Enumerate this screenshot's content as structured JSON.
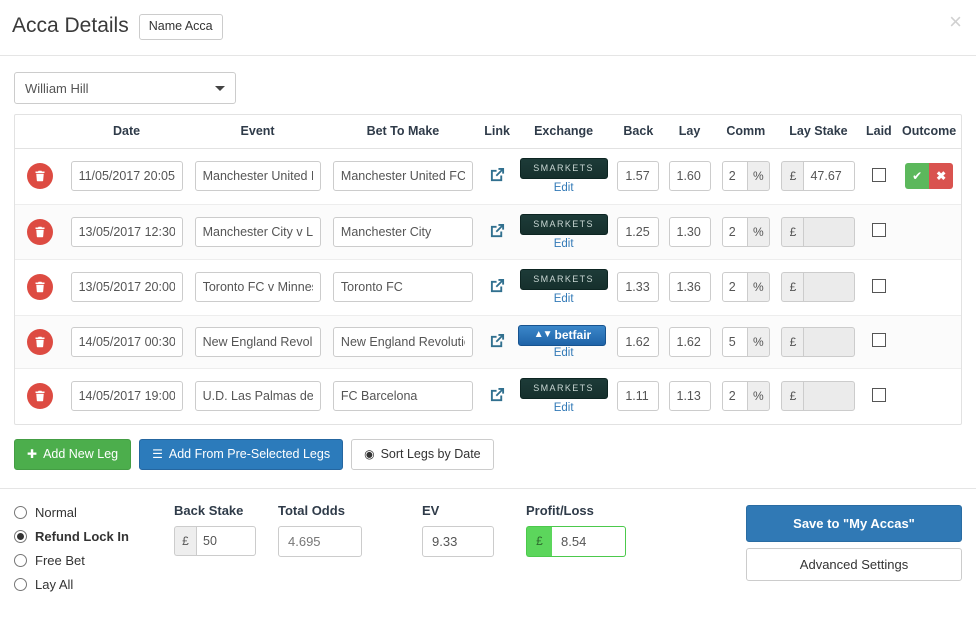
{
  "header": {
    "title": "Acca Details",
    "name_acca_label": "Name Acca",
    "close_icon": "close-icon"
  },
  "bookmaker": {
    "selected": "William Hill",
    "caret_icon": "chevron-down-icon"
  },
  "table": {
    "columns": [
      "",
      "Date",
      "Event",
      "Bet To Make",
      "Link",
      "Exchange",
      "Back",
      "Lay",
      "Comm",
      "Lay Stake",
      "Laid",
      "Outcome"
    ],
    "rows": [
      {
        "date": "11/05/2017 20:05",
        "event": "Manchester United FC ",
        "bet": "Manchester United FC",
        "link_icon": "external-link-icon",
        "exchange": "SMARKETS",
        "exchange_key": "smarkets",
        "edit_label": "Edit",
        "back": "1.57",
        "lay": "1.60",
        "comm": "2",
        "comm_unit": "%",
        "stake_currency": "£",
        "lay_stake": "47.67",
        "stake_disabled": false,
        "laid": false,
        "has_outcome": true,
        "win_icon": "✔",
        "lose_icon": "✖"
      },
      {
        "date": "13/05/2017 12:30",
        "event": "Manchester City v Leice",
        "bet": "Manchester City",
        "link_icon": "external-link-icon",
        "exchange": "SMARKETS",
        "exchange_key": "smarkets",
        "edit_label": "Edit",
        "back": "1.25",
        "lay": "1.30",
        "comm": "2",
        "comm_unit": "%",
        "stake_currency": "£",
        "lay_stake": "",
        "stake_disabled": true,
        "laid": false,
        "has_outcome": false
      },
      {
        "date": "13/05/2017 20:00",
        "event": "Toronto FC v Minnesota",
        "bet": "Toronto FC",
        "link_icon": "external-link-icon",
        "exchange": "SMARKETS",
        "exchange_key": "smarkets",
        "edit_label": "Edit",
        "back": "1.33",
        "lay": "1.36",
        "comm": "2",
        "comm_unit": "%",
        "stake_currency": "£",
        "lay_stake": "",
        "stake_disabled": true,
        "laid": false,
        "has_outcome": false
      },
      {
        "date": "14/05/2017 00:30",
        "event": "New England Revolutic",
        "bet": "New England Revolutic",
        "link_icon": "external-link-icon",
        "exchange": "betfair",
        "exchange_key": "betfair",
        "edit_label": "Edit",
        "back": "1.62",
        "lay": "1.62",
        "comm": "5",
        "comm_unit": "%",
        "stake_currency": "£",
        "lay_stake": "",
        "stake_disabled": true,
        "laid": false,
        "has_outcome": false
      },
      {
        "date": "14/05/2017 19:00",
        "event": "U.D. Las Palmas de Gr",
        "bet": "FC Barcelona",
        "link_icon": "external-link-icon",
        "exchange": "SMARKETS",
        "exchange_key": "smarkets",
        "edit_label": "Edit",
        "back": "1.11",
        "lay": "1.13",
        "comm": "2",
        "comm_unit": "%",
        "stake_currency": "£",
        "lay_stake": "",
        "stake_disabled": true,
        "laid": false,
        "has_outcome": false
      }
    ],
    "delete_icon": "trash-icon"
  },
  "actions": {
    "add_new_leg": "Add New Leg",
    "add_new_leg_icon": "plus-circle-icon",
    "add_preselected": "Add From Pre-Selected Legs",
    "add_preselected_icon": "list-icon",
    "sort_by_date": "Sort Legs by Date",
    "sort_by_date_icon": "clock-icon"
  },
  "bottom": {
    "modes": [
      {
        "label": "Normal",
        "selected": false
      },
      {
        "label": "Refund Lock In",
        "selected": true
      },
      {
        "label": "Free Bet",
        "selected": false
      },
      {
        "label": "Lay All",
        "selected": false
      }
    ],
    "back_stake_label": "Back Stake",
    "back_stake_currency": "£",
    "back_stake_value": "50",
    "total_odds_label": "Total Odds",
    "total_odds_value": "4.695",
    "ev_label": "EV",
    "ev_value": "9.33",
    "pl_label": "Profit/Loss",
    "pl_currency": "£",
    "pl_value": "8.54",
    "save_label": "Save to \"My Accas\"",
    "advanced_label": "Advanced Settings"
  },
  "colors": {
    "primary_blue": "#3079b5",
    "success_green": "#4cae4c",
    "danger_red": "#dd4b42",
    "smarkets_dark": "#1d3b38",
    "betfair_blue": "#2f79bd"
  }
}
